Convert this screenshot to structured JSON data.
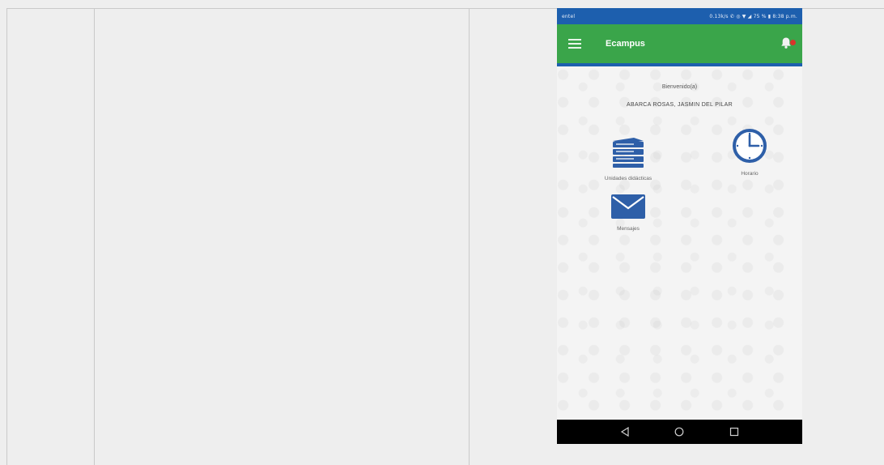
{
  "phone": {
    "status_bar": {
      "left": "entel",
      "right": "0.13k/s ✆ ◎ ▼ ◢ 75 % ▮ 8:38 p.m."
    },
    "app_bar": {
      "title": "Ecampus",
      "notification_count": "0"
    },
    "greeting": "Bienvenido(a)",
    "student_name": "ABARCA ROSAS, JASMIN DEL PILAR",
    "tiles": {
      "units": {
        "label": "Unidades didácticas",
        "icon": "books-icon"
      },
      "schedule": {
        "label": "Horario",
        "icon": "clock-icon"
      },
      "messages": {
        "label": "Mensajes",
        "icon": "envelope-icon"
      }
    },
    "nav": {
      "back": "back-icon",
      "home": "home-icon",
      "recents": "recents-icon"
    },
    "colors": {
      "status": "#1d5fae",
      "appbar": "#3aa54a",
      "icon": "#2e5fa8",
      "badge": "#d9342b"
    }
  }
}
